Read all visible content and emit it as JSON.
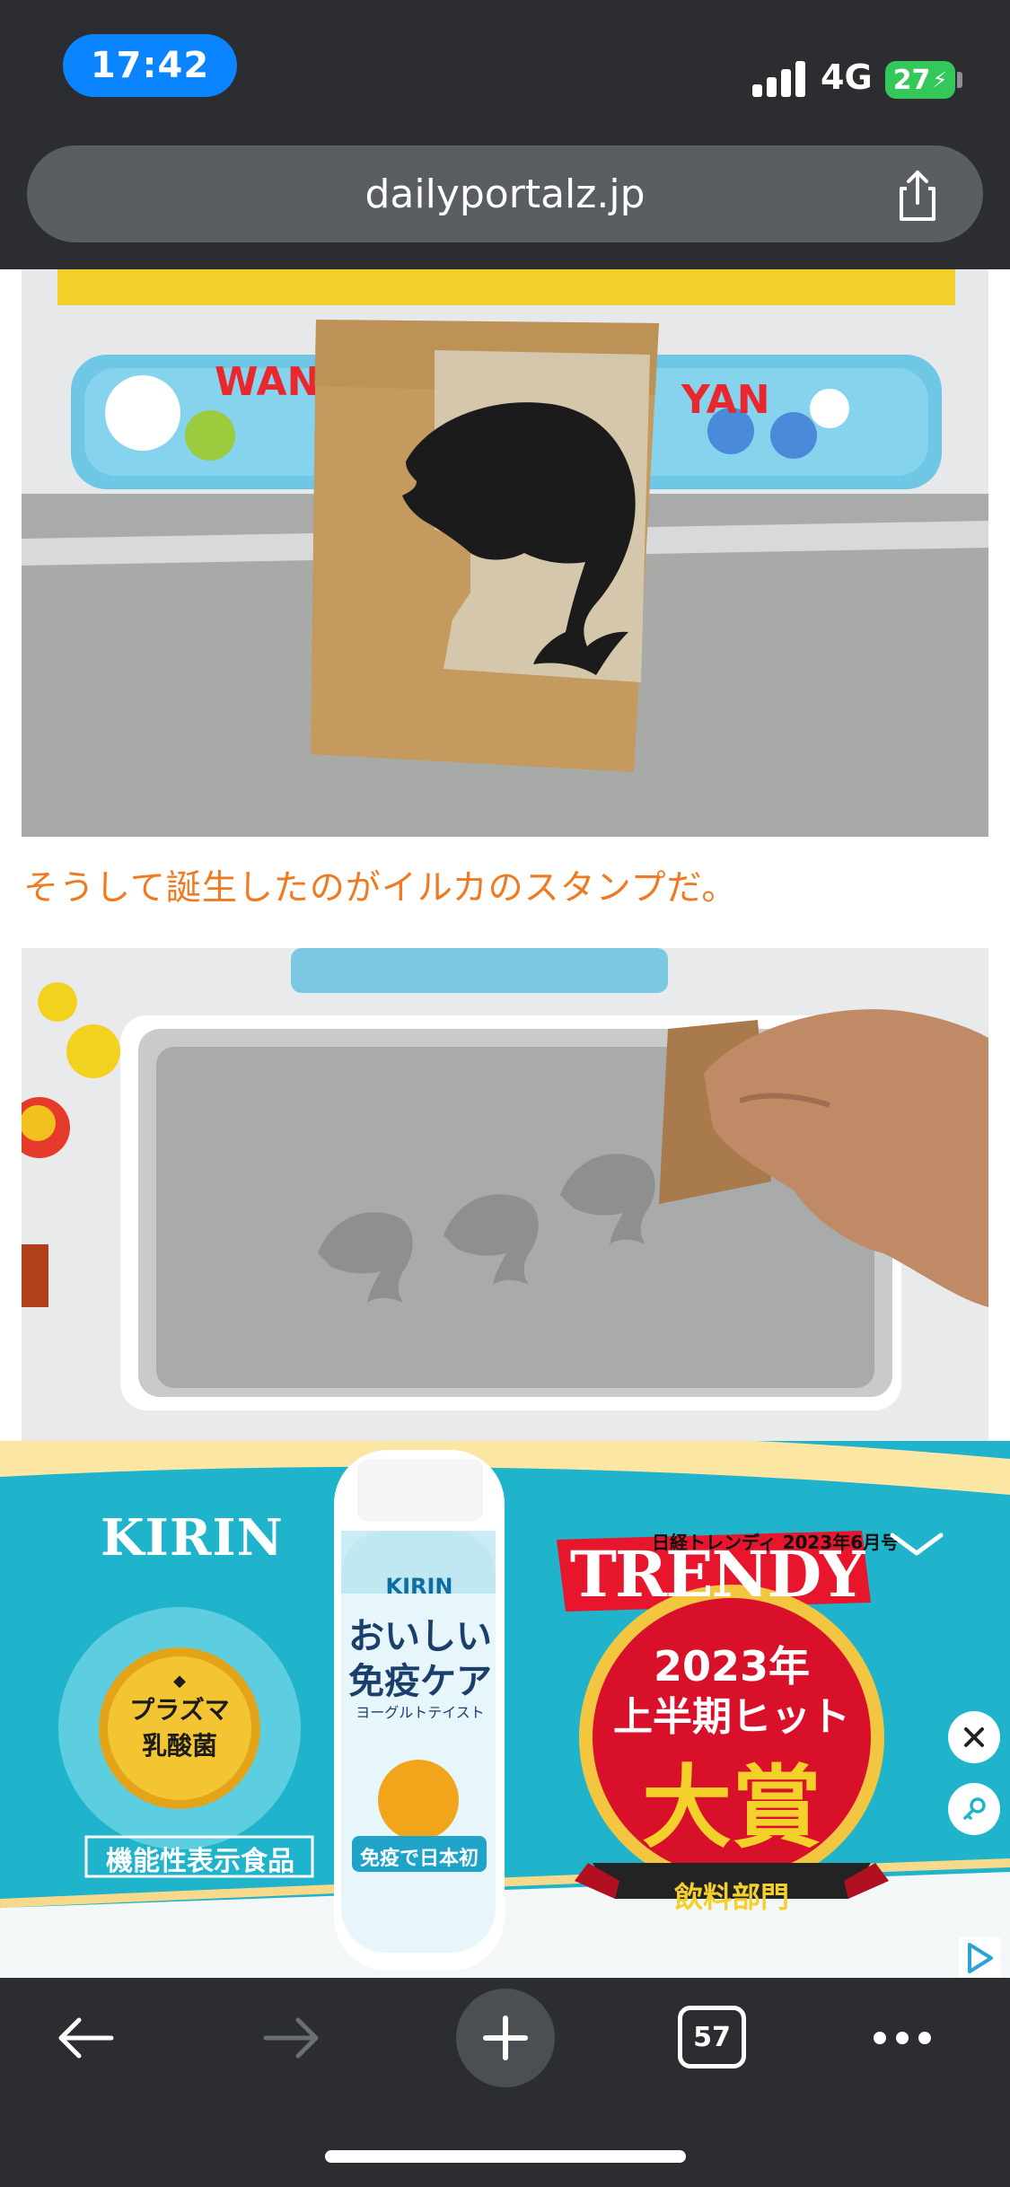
{
  "status_bar": {
    "time": "17:42",
    "network": "4G",
    "battery": "27"
  },
  "browser": {
    "url": "dailyportalz.jp",
    "tab_count": "57"
  },
  "article": {
    "caption": "そうして誕生したのがイルカのスタンプだ。"
  },
  "ad": {
    "brand": "KIRIN",
    "badge_line1": "プラズマ",
    "badge_line2": "乳酸菌",
    "functional_label": "機能性表示食品",
    "bottle_brand": "KIRIN",
    "bottle_title_1": "おいしい",
    "bottle_title_2": "免疫ケア",
    "bottle_sub": "ヨーグルトテイスト",
    "bottle_claim": "免疫で日本初",
    "magazine_header": "日経トレンディ 2023年6月号",
    "magazine_name": "TRENDY",
    "award_year": "2023年",
    "award_period": "上半期ヒット",
    "award_title": "大賞",
    "award_category": "飲料部門"
  },
  "colors": {
    "accent_caption": "#f07a22",
    "ad_background": "#1fb3cc",
    "time_pill": "#0a84ff",
    "battery": "#34c759"
  }
}
